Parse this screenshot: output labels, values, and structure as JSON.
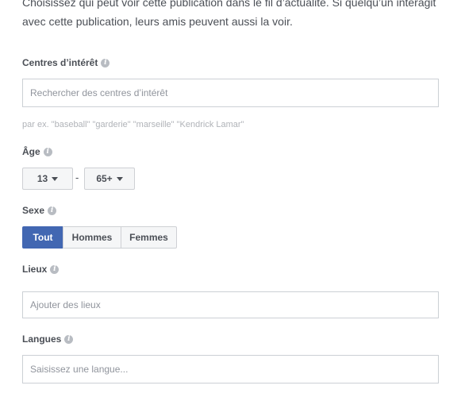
{
  "intro": {
    "text": "Choisissez qui peut voir cette publication dans le fil d’actualité. Si quelqu’un interagit avec cette publication, leurs amis peuvent aussi la voir."
  },
  "interests": {
    "label": "Centres d’intérêt",
    "placeholder": "Rechercher des centres d’intérêt",
    "hint": "par ex. \"baseball\" \"garderie\" \"marseille\" \"Kendrick Lamar\""
  },
  "age": {
    "label": "Âge",
    "min": "13",
    "separator": "-",
    "max": "65+"
  },
  "sex": {
    "label": "Sexe",
    "options": [
      "Tout",
      "Hommes",
      "Femmes"
    ],
    "selected": "Tout"
  },
  "locations": {
    "label": "Lieux",
    "placeholder": "Ajouter des lieux"
  },
  "languages": {
    "label": "Langues",
    "placeholder": "Saisissez une langue..."
  },
  "icons": {
    "info": "info-icon",
    "dropdown": "caret-down-icon"
  },
  "colors": {
    "accent": "#4267b2",
    "border": "#ccd0d5",
    "label": "#4b4f56"
  }
}
